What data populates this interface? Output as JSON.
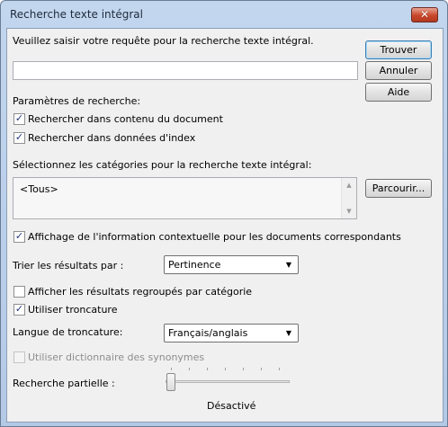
{
  "window": {
    "title": "Recherche texte intégral",
    "close_glyph": "✕"
  },
  "query": {
    "prompt": "Veuillez saisir votre requête pour la recherche texte intégral.",
    "value": "",
    "placeholder": ""
  },
  "buttons": {
    "find": "Trouver",
    "cancel": "Annuler",
    "help": "Aide",
    "browse": "Parcourir..."
  },
  "search_params": {
    "heading": "Paramètres de recherche:",
    "in_content": {
      "label": "Rechercher dans contenu du document",
      "checked": true
    },
    "in_index": {
      "label": "Rechercher dans données d'index",
      "checked": true
    }
  },
  "categories": {
    "label": "Sélectionnez les catégories pour la recherche texte intégral:",
    "items": [
      "<Tous>"
    ]
  },
  "context_info": {
    "label": "Affichage de l'information contextuelle pour les documents correspondants",
    "checked": true
  },
  "sort": {
    "label": "Trier les résultats par :",
    "selected": "Pertinence"
  },
  "group_by_category": {
    "label": "Afficher les résultats regroupés par catégorie",
    "checked": false
  },
  "truncation": {
    "label": "Utiliser troncature",
    "checked": true
  },
  "truncation_language": {
    "label": "Langue de troncature:",
    "selected": "Français/anglais"
  },
  "synonyms": {
    "label": "Utiliser dictionnaire des synonymes",
    "checked": false,
    "enabled": false
  },
  "partial_search": {
    "label": "Recherche partielle :",
    "level": 0,
    "value_label": "Désactivé"
  },
  "icons": {
    "check": "check-icon",
    "dropdown": "chevron-down-icon",
    "scroll_up": "scroll-up-icon",
    "scroll_down": "scroll-down-icon"
  }
}
